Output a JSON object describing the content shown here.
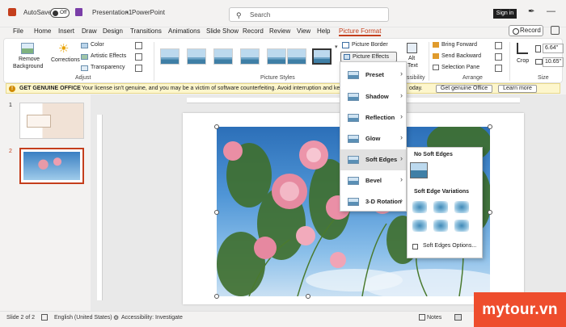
{
  "titlebar": {
    "autosave_label": "AutoSave",
    "autosave_state": "Off",
    "doc_title": "Presentation1",
    "app_sep": "•",
    "app_name": "PowerPoint",
    "search_placeholder": "Search",
    "signin": "Sign in"
  },
  "tabs": [
    {
      "label": "File"
    },
    {
      "label": "Home"
    },
    {
      "label": "Insert"
    },
    {
      "label": "Draw"
    },
    {
      "label": "Design"
    },
    {
      "label": "Transitions"
    },
    {
      "label": "Animations"
    },
    {
      "label": "Slide Show"
    },
    {
      "label": "Record"
    },
    {
      "label": "Review"
    },
    {
      "label": "View"
    },
    {
      "label": "Help"
    },
    {
      "label": "Picture Format"
    }
  ],
  "record_button": "Record",
  "ribbon": {
    "remove_bg": [
      "Remove",
      "Background"
    ],
    "corrections": "Corrections",
    "color": "Color",
    "artistic": "Artistic Effects",
    "transparency": "Transparency",
    "adjust_label": "Adjust",
    "styles_label": "Picture Styles",
    "border": "Picture Border",
    "effects": "Picture Effects",
    "alt_text": [
      "Alt",
      "Text"
    ],
    "accessibility_label": "ssibility",
    "bring_forward": "Bring Forward",
    "send_backward": "Send Backward",
    "selection_pane": "Selection Pane",
    "arrange_label": "Arrange",
    "crop": "Crop",
    "height": "6.64\"",
    "width": "10.65\"",
    "size_label": "Size"
  },
  "infobar": {
    "title": "GET GENUINE OFFICE",
    "message": "Your license isn't genuine, and you may be a victim of software counterfeiting. Avoid interruption and keep your",
    "message_end": "oday.",
    "btn_genuine": "Get genuine Office",
    "btn_learn": "Learn more"
  },
  "slides": [
    {
      "number": "1"
    },
    {
      "number": "2"
    }
  ],
  "effects_menu": [
    {
      "label": "Preset"
    },
    {
      "label": "Shadow"
    },
    {
      "label": "Reflection"
    },
    {
      "label": "Glow"
    },
    {
      "label": "Soft Edges"
    },
    {
      "label": "Bevel"
    },
    {
      "label": "3-D Rotation"
    }
  ],
  "soft_edges": {
    "none_label": "No Soft Edges",
    "variations_label": "Soft Edge Variations",
    "options": "Soft Edges Options..."
  },
  "statusbar": {
    "slide_info": "Slide 2 of 2",
    "language": "English (United States)",
    "accessibility": "Accessibility: Investigate",
    "notes": "Notes"
  },
  "watermark": "mytour.vn",
  "colors": {
    "accent": "#c43e1c",
    "watermark": "#ee4d2d"
  }
}
